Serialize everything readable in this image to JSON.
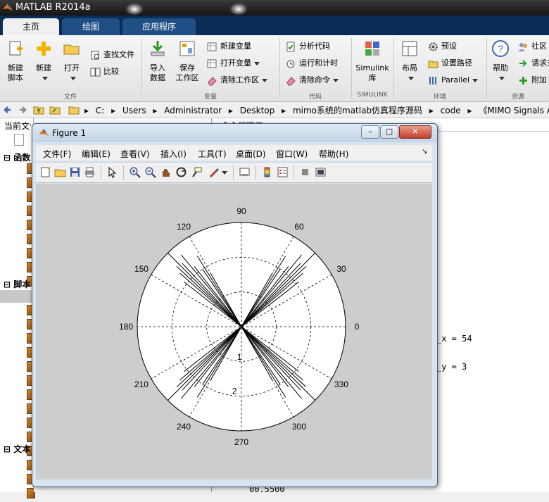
{
  "app": {
    "title": "MATLAB R2014a"
  },
  "tabs": [
    {
      "label": "主页",
      "active": true
    },
    {
      "label": "绘图",
      "active": false
    },
    {
      "label": "应用程序",
      "active": false
    }
  ],
  "ribbon": {
    "file": {
      "group_label": "文件",
      "new_script": "新建\n脚本",
      "new": "新建",
      "open": "打开",
      "find_files": "查找文件",
      "compare": "比较"
    },
    "variable": {
      "group_label": "变量",
      "import_data": "导入\n数据",
      "save_workspace": "保存\n工作区",
      "new_variable": "新建变量",
      "open_variable": "打开变量",
      "clear_workspace": "清除工作区"
    },
    "code": {
      "group_label": "代码",
      "analyze_code": "分析代码",
      "run_and_time": "运行和计时",
      "clear_commands": "清除命令"
    },
    "simulink": {
      "group_label": "SIMULINK",
      "library": "Simulink\n库"
    },
    "environment": {
      "group_label": "环境",
      "layout": "布局",
      "preferences": "预设",
      "set_path": "设置路径",
      "parallel": "Parallel"
    },
    "resources": {
      "group_label": "资源",
      "help": "帮助",
      "community": "社区",
      "request_support": "请求支",
      "addons": "附加"
    }
  },
  "address": {
    "crumbs": [
      "C:",
      "Users",
      "Administrator",
      "Desktop",
      "mimo系统的matlab仿真程序源码",
      "code",
      "《MIMO Signals And S"
    ]
  },
  "left_panel": {
    "current_folder_label": "当前文件夹",
    "section_functions": "函数",
    "section_scripts": "脚本",
    "section_text": "文本"
  },
  "command_window": {
    "title": "命令行窗口",
    "line1": "_x = 54",
    "line2": "_y = 3",
    "line3": "00.5500"
  },
  "figure": {
    "title": "Figure 1",
    "menu": [
      "文件(F)",
      "编辑(E)",
      "查看(V)",
      "插入(I)",
      "工具(T)",
      "桌面(D)",
      "窗口(W)",
      "帮助(H)"
    ],
    "toolbar_icons": [
      "new-figure-icon",
      "open-file-icon",
      "save-icon",
      "print-icon",
      "pointer-icon",
      "zoom-in-icon",
      "zoom-out-icon",
      "pan-icon",
      "rotate-icon",
      "data-cursor-icon",
      "brush-icon",
      "link-icon",
      "colorbar-icon",
      "legend-icon",
      "hide-tools-icon",
      "show-tools-icon"
    ],
    "polar": {
      "angle_labels": [
        "0",
        "30",
        "60",
        "90",
        "120",
        "150",
        "180",
        "210",
        "240",
        "270",
        "300",
        "330"
      ],
      "angles_deg": [
        0,
        30,
        60,
        90,
        120,
        150,
        180,
        210,
        240,
        270,
        300,
        330
      ],
      "radial_labels": [
        "1",
        "2"
      ],
      "rmax": 3
    }
  },
  "colors": {
    "accent": "#0b2c54",
    "tab_active": "#f0f0f0",
    "plot_bg": "#cdcdcd"
  }
}
